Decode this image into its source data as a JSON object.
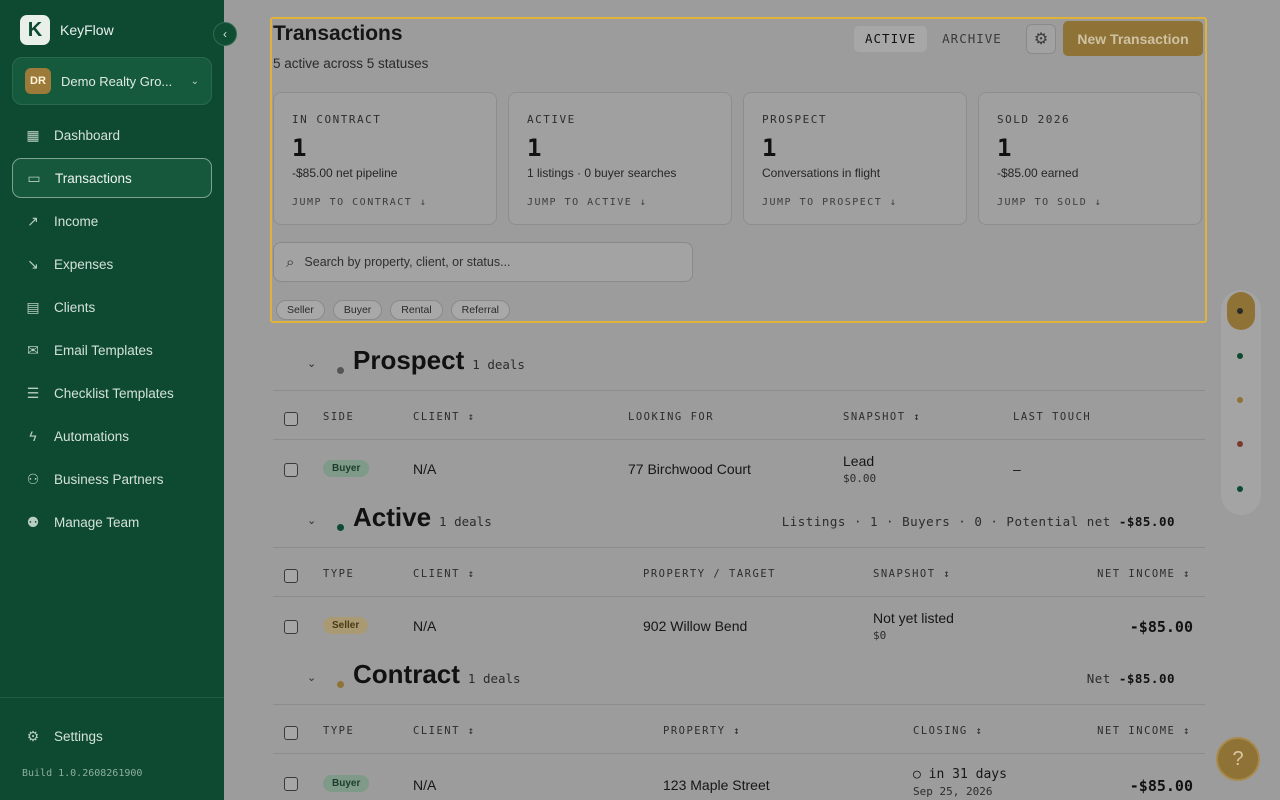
{
  "app": {
    "name": "KeyFlow",
    "logo_letter": "K"
  },
  "org": {
    "initials": "DR",
    "name": "Demo Realty Gro..."
  },
  "nav": [
    {
      "label": "Dashboard",
      "icon": "dashboard-icon",
      "glyph": "▦"
    },
    {
      "label": "Transactions",
      "icon": "briefcase-icon",
      "glyph": "▭"
    },
    {
      "label": "Income",
      "icon": "trend-up-icon",
      "glyph": "↗"
    },
    {
      "label": "Expenses",
      "icon": "trend-down-icon",
      "glyph": "↘"
    },
    {
      "label": "Clients",
      "icon": "contacts-icon",
      "glyph": "▤"
    },
    {
      "label": "Email Templates",
      "icon": "mail-icon",
      "glyph": "✉"
    },
    {
      "label": "Checklist Templates",
      "icon": "checklist-icon",
      "glyph": "☰"
    },
    {
      "label": "Automations",
      "icon": "bolt-icon",
      "glyph": "ϟ"
    },
    {
      "label": "Business Partners",
      "icon": "partners-icon",
      "glyph": "⚇"
    },
    {
      "label": "Manage Team",
      "icon": "team-icon",
      "glyph": "⚉"
    }
  ],
  "settings_label": "Settings",
  "build": "Build 1.0.2608261900",
  "header": {
    "title": "Transactions",
    "subtitle": "5 active across 5 statuses",
    "tab_active": "ACTIVE",
    "tab_archive": "ARCHIVE",
    "new_button": "New Transaction"
  },
  "cards": [
    {
      "label": "IN CONTRACT",
      "value": "1",
      "desc": "-$85.00 net pipeline",
      "jump": "JUMP TO CONTRACT ↓"
    },
    {
      "label": "ACTIVE",
      "value": "1",
      "desc": "1 listings · 0 buyer searches",
      "jump": "JUMP TO ACTIVE ↓"
    },
    {
      "label": "PROSPECT",
      "value": "1",
      "desc": "Conversations in flight",
      "jump": "JUMP TO PROSPECT ↓"
    },
    {
      "label": "SOLD 2026",
      "value": "1",
      "desc": "-$85.00 earned",
      "jump": "JUMP TO SOLD ↓"
    }
  ],
  "search": {
    "placeholder": "Search by property, client, or status..."
  },
  "filters": [
    "Seller",
    "Buyer",
    "Rental",
    "Referral"
  ],
  "sections": {
    "prospect": {
      "title": "Prospect",
      "count": "1 deals",
      "columns": [
        "SIDE",
        "CLIENT ↕",
        "LOOKING FOR",
        "SNAPSHOT ↕",
        "LAST TOUCH"
      ],
      "row": {
        "badge": "Buyer",
        "client": "N/A",
        "looking_for": "77 Birchwood Court",
        "snapshot": "Lead",
        "snapshot_sub": "$0.00",
        "last_touch": "–"
      }
    },
    "active": {
      "title": "Active",
      "count": "1 deals",
      "summary_prefix": "Listings · 1 · Buyers · 0 · Potential net",
      "summary_value": "-$85.00",
      "columns": [
        "TYPE",
        "CLIENT ↕",
        "PROPERTY / TARGET",
        "SNAPSHOT ↕",
        "NET INCOME ↕"
      ],
      "row": {
        "badge": "Seller",
        "client": "N/A",
        "property": "902 Willow Bend",
        "snapshot": "Not yet listed",
        "snapshot_sub": "$0",
        "net": "-$85.00"
      }
    },
    "contract": {
      "title": "Contract",
      "count": "1 deals",
      "summary_prefix": "Net",
      "summary_value": "-$85.00",
      "columns": [
        "TYPE",
        "CLIENT ↕",
        "PROPERTY ↕",
        "CLOSING ↕",
        "NET INCOME ↕"
      ],
      "row": {
        "badge": "Buyer",
        "client": "N/A",
        "property": "123 Maple Street",
        "closing": "○ in 31 days",
        "closing_sub": "Sep 25, 2026",
        "net": "-$85.00"
      }
    }
  },
  "colors": {
    "sidebar": "#0e4a32",
    "accent": "#8f7236",
    "highlight": "#e0b23a",
    "prospect_dot": "#555555",
    "active_dot": "#0e4a32",
    "contract_dot": "#8f7236",
    "sold_dot": "#7a3a2a"
  },
  "help_glyph": "?"
}
